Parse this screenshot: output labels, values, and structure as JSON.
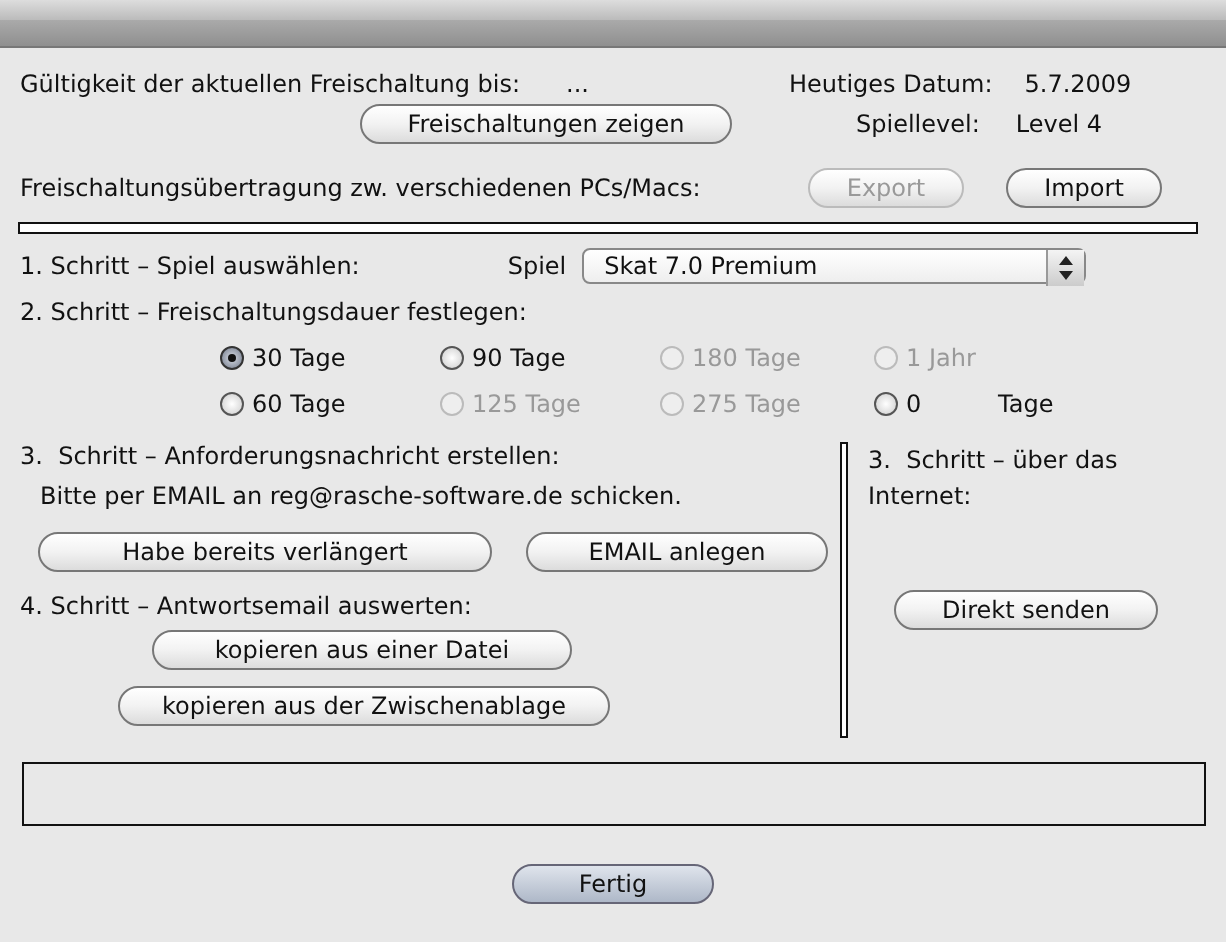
{
  "header": {
    "validity_label": "Gültigkeit der aktuellen Freischaltung bis:",
    "validity_value": "...",
    "date_label": "Heutiges Datum:",
    "date_value": "5.7.2009",
    "level_label": "Spiellevel:",
    "level_value": "Level 4",
    "show_button": {
      "label": "Freischaltungen zeigen",
      "disabled": false
    }
  },
  "transfer": {
    "label": "Freischaltungsübertragung zw. verschiedenen PCs/Macs:",
    "buttons": [
      {
        "label": "Export",
        "disabled": true
      },
      {
        "label": "Import",
        "disabled": false
      }
    ]
  },
  "step1": {
    "label": "1. Schritt – Spiel auswählen:",
    "select_label": "Spiel",
    "select_value": "Skat 7.0 Premium"
  },
  "step2": {
    "label": "2. Schritt – Freischaltungsdauer festlegen:",
    "options": [
      {
        "label": "30 Tage",
        "selected": true,
        "disabled": false
      },
      {
        "label": "90 Tage",
        "selected": false,
        "disabled": false
      },
      {
        "label": "180 Tage",
        "selected": false,
        "disabled": true
      },
      {
        "label": "1 Jahr",
        "selected": false,
        "disabled": true
      },
      {
        "label": "60 Tage",
        "selected": false,
        "disabled": false
      },
      {
        "label": "125 Tage",
        "selected": false,
        "disabled": true
      },
      {
        "label": "275 Tage",
        "selected": false,
        "disabled": true
      },
      {
        "label": "0",
        "selected": false,
        "disabled": false
      }
    ],
    "unit": "Tage"
  },
  "step3": {
    "label": "3.  Schritt – Anforderungsnachricht erstellen:",
    "instruction": "Bitte per EMAIL an reg@rasche-software.de schicken.",
    "buttons": [
      {
        "label": "Habe bereits verlängert",
        "disabled": false
      },
      {
        "label": "EMAIL anlegen",
        "disabled": false
      }
    ]
  },
  "step4": {
    "label": "4. Schritt – Antwortsemail auswerten:",
    "buttons": [
      {
        "label": "kopieren aus einer Datei",
        "disabled": false
      },
      {
        "label": "kopieren aus der Zwischenablage",
        "disabled": false
      }
    ]
  },
  "internet": {
    "label": "3.  Schritt – über das Internet:",
    "button": {
      "label": "Direkt senden",
      "disabled": false
    }
  },
  "footer_button": {
    "label": "Fertig",
    "default": true
  }
}
